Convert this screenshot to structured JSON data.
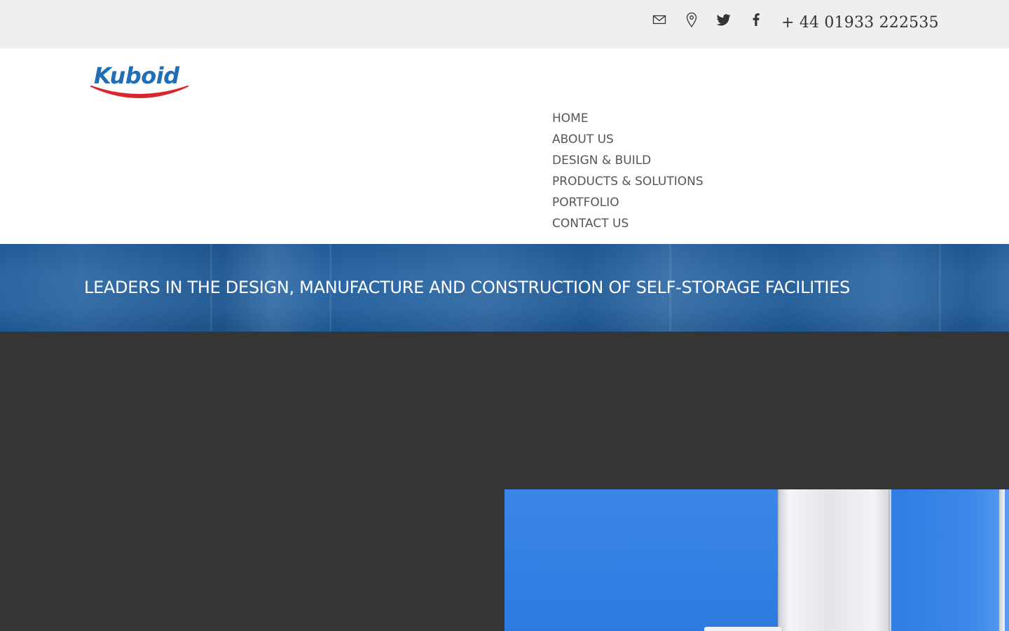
{
  "topbar": {
    "icons": [
      "envelope-icon",
      "map-pin-icon",
      "twitter-icon",
      "facebook-icon"
    ],
    "phone": "+ 44 01933 222535"
  },
  "logo": {
    "text": "Kuboid",
    "colors": {
      "text": "#1e6fb8",
      "swoosh": "#d9262c"
    }
  },
  "nav": {
    "items": [
      {
        "label": "HOME"
      },
      {
        "label": "ABOUT US"
      },
      {
        "label": "DESIGN & BUILD"
      },
      {
        "label": "PRODUCTS & SOLUTIONS"
      },
      {
        "label": "PORTFOLIO"
      },
      {
        "label": "CONTACT US"
      }
    ]
  },
  "banner": {
    "tagline": "LEADERS IN THE DESIGN, MANUFACTURE AND CONSTRUCTION OF SELF-STORAGE FACILITIES"
  },
  "colors": {
    "topbar_bg": "#efefef",
    "banner_blue": "#2b66a3",
    "dark_section": "#353535",
    "nav_text": "#555555"
  }
}
